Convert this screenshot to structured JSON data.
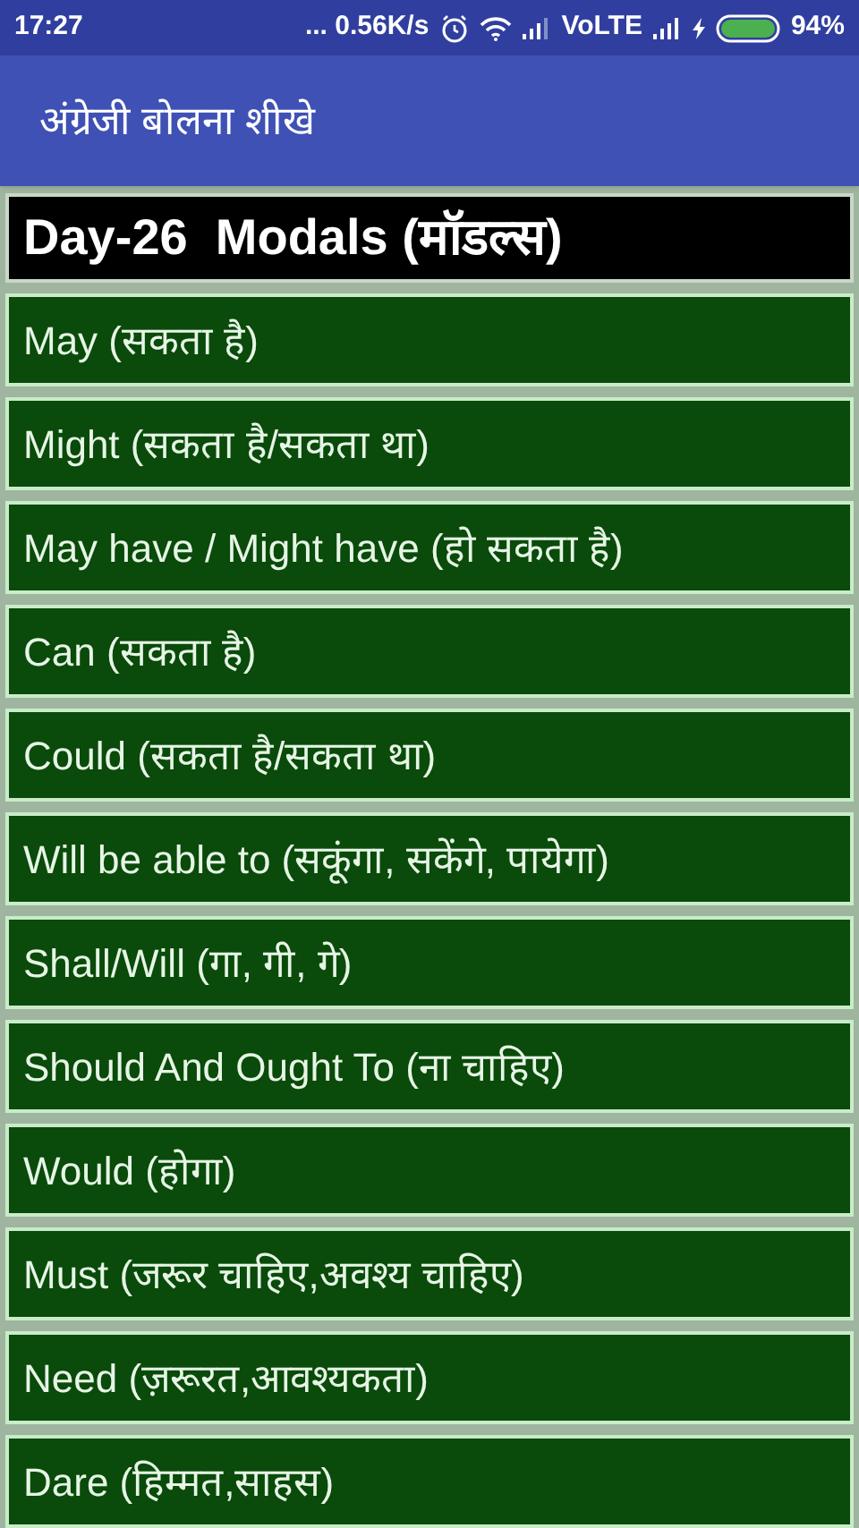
{
  "status_bar": {
    "time": "17:27",
    "speed": "... 0.56K/s",
    "network": "VoLTE",
    "battery": "94%"
  },
  "app_bar": {
    "title": "अंग्रेजी बोलना शीखे"
  },
  "lesson": {
    "title": "Day-26  Modals (मॉडल्स)",
    "items": [
      "May (सकता है)",
      "Might (सकता है/सकता था)",
      "May have / Might have (हो सकता है)",
      "Can (सकता है)",
      "Could (सकता है/सकता था)",
      "Will be able to (सकूंगा, सकेंगे, पायेगा)",
      "Shall/Will (गा, गी, गे)",
      "Should And Ought To (ना चाहिए)",
      "Would (होगा)",
      "Must (जरूर चाहिए,अवश्य चाहिए)",
      "Need (ज़रूरत,आवश्यकता)",
      "Dare (हिम्मत,साहस)"
    ]
  }
}
